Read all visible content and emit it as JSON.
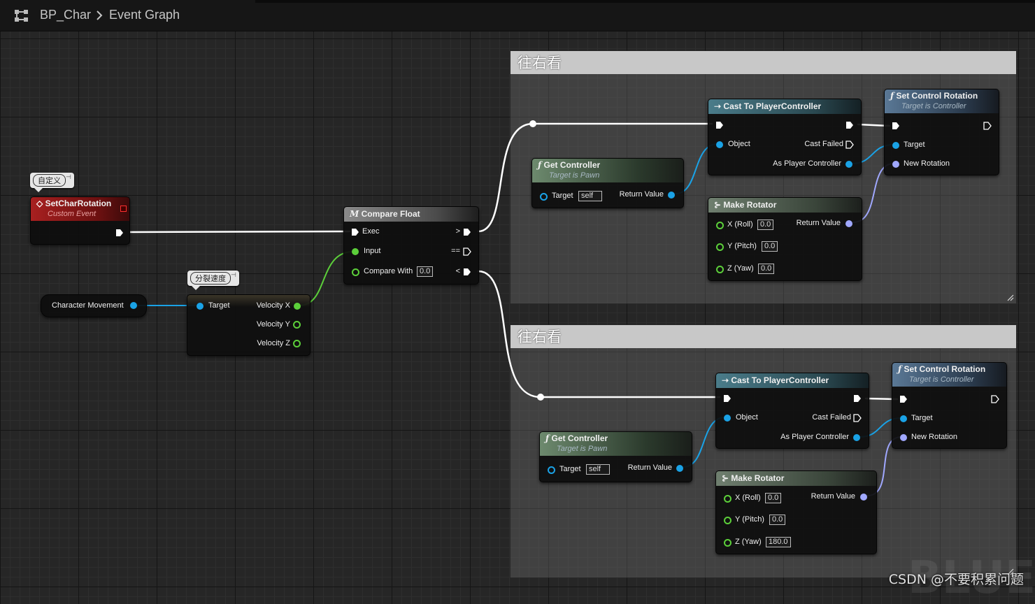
{
  "breadcrumb": {
    "blueprint": "BP_Char",
    "graph": "Event Graph",
    "icon": "blueprint-graph-icon"
  },
  "comments": [
    {
      "title": "往右看"
    },
    {
      "title": "往右看"
    }
  ],
  "event_node": {
    "comment_bubble": "自定义",
    "title": "SetCharRotation",
    "subtitle": "Custom Event",
    "header_color": "#a82020"
  },
  "char_movement": {
    "label": "Character Movement"
  },
  "break_vector": {
    "comment_bubble": "分裂速度",
    "target": "Target",
    "outputs": [
      "Velocity X",
      "Velocity Y",
      "Velocity Z"
    ]
  },
  "compare_float": {
    "icon": "M",
    "title": "Compare Float",
    "exec": "Exec",
    "input": "Input",
    "compare_with": "Compare With",
    "compare_value": "0.0",
    "out_gt": ">",
    "out_eq": "==",
    "out_lt": "<"
  },
  "groups": [
    {
      "get_controller": {
        "title": "Get Controller",
        "subtitle": "Target is Pawn",
        "target": "Target",
        "target_value": "self",
        "return": "Return Value"
      },
      "cast": {
        "title": "Cast To PlayerController",
        "object": "Object",
        "cast_failed": "Cast Failed",
        "as_pc": "As Player Controller"
      },
      "set_rotation": {
        "title": "Set Control Rotation",
        "subtitle": "Target is Controller",
        "target": "Target",
        "new_rotation": "New Rotation"
      },
      "make_rotator": {
        "title": "Make Rotator",
        "x_label": "X (Roll)",
        "x": "0.0",
        "y_label": "Y (Pitch)",
        "y": "0.0",
        "z_label": "Z (Yaw)",
        "z": "0.0",
        "return": "Return Value"
      }
    },
    {
      "get_controller": {
        "title": "Get Controller",
        "subtitle": "Target is Pawn",
        "target": "Target",
        "target_value": "self",
        "return": "Return Value"
      },
      "cast": {
        "title": "Cast To PlayerController",
        "object": "Object",
        "cast_failed": "Cast Failed",
        "as_pc": "As Player Controller"
      },
      "set_rotation": {
        "title": "Set Control Rotation",
        "subtitle": "Target is Controller",
        "target": "Target",
        "new_rotation": "New Rotation"
      },
      "make_rotator": {
        "title": "Make Rotator",
        "x_label": "X (Roll)",
        "x": "0.0",
        "y_label": "Y (Pitch)",
        "y": "0.0",
        "z_label": "Z (Yaw)",
        "z": "180.0",
        "return": "Return Value"
      }
    }
  ],
  "watermark": "CSDN @不要积累问题",
  "watermark_bg": "BLUEPI",
  "colors": {
    "object_pin": "#1aa2e6",
    "float_pin": "#5ccf3a",
    "struct_pin": "#a0a8ff",
    "exec": "#ffffff"
  }
}
